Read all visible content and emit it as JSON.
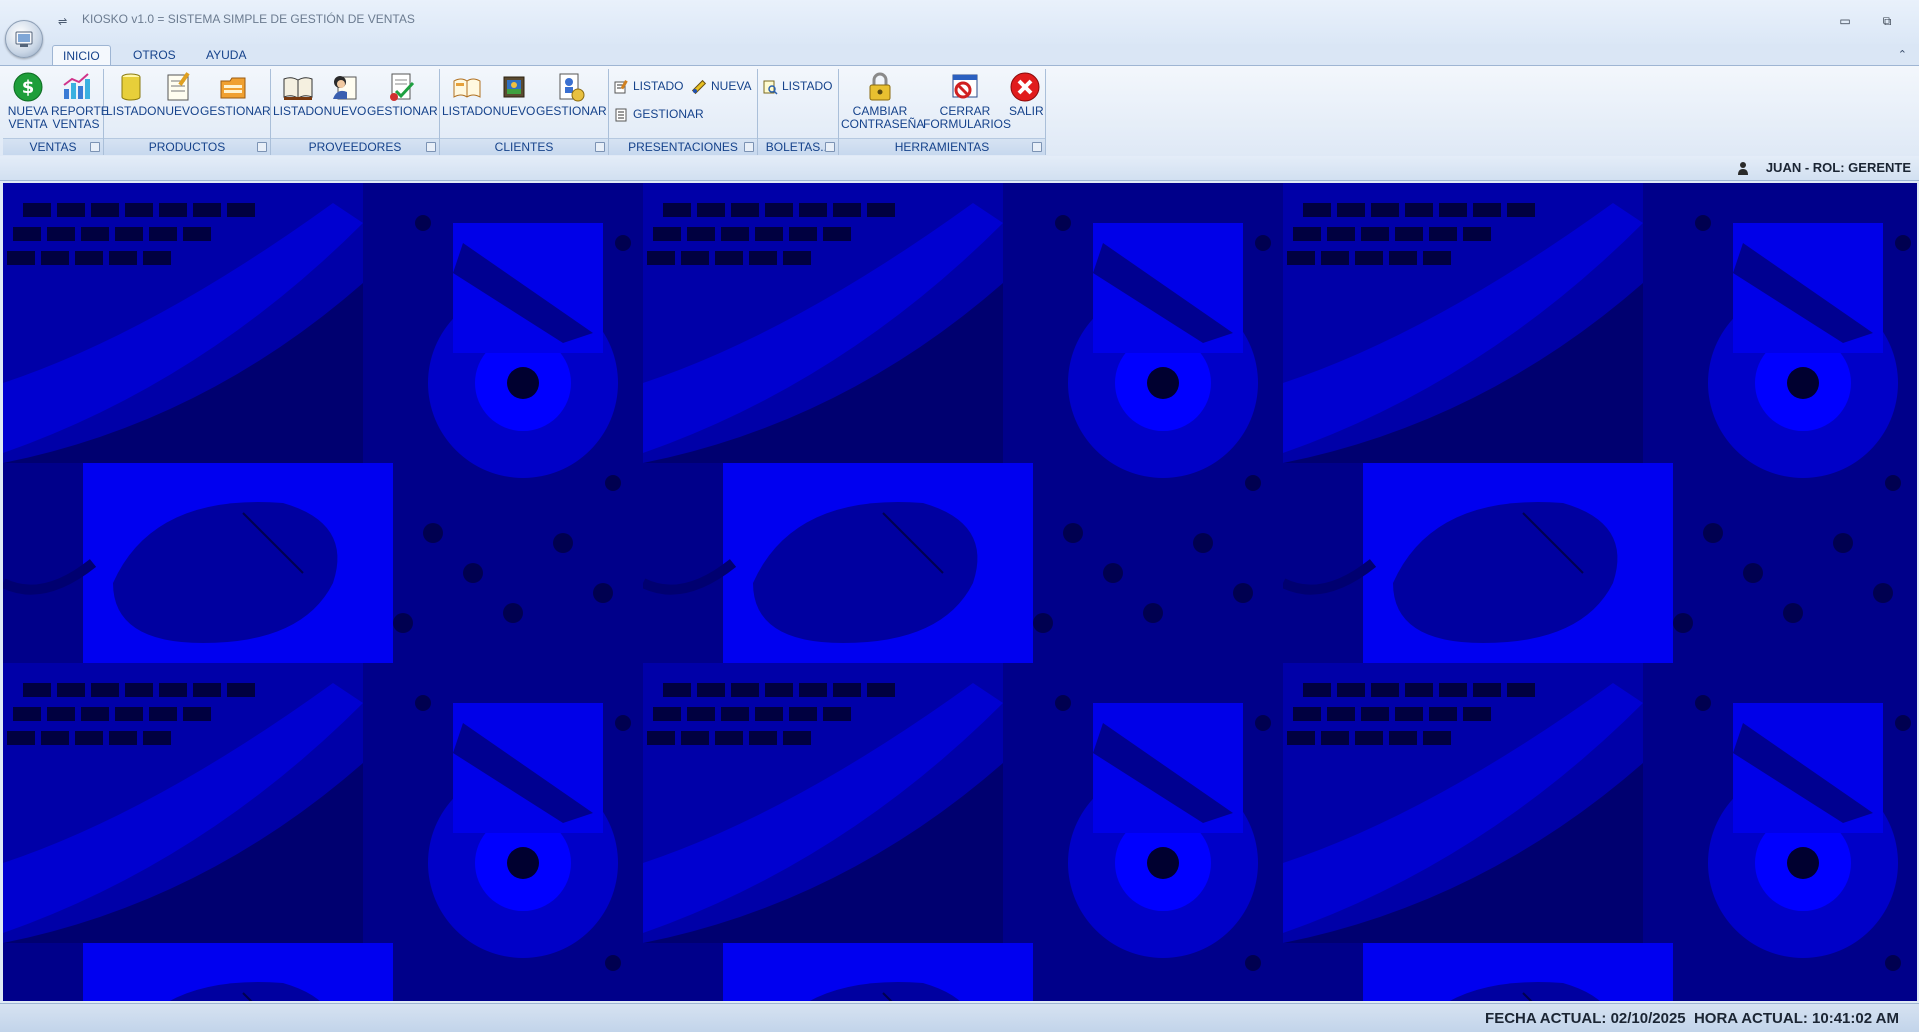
{
  "window": {
    "title": "KIOSKO v1.0 = SISTEMA SIMPLE DE GESTIÓN DE VENTAS",
    "qat_symbol": "⇌",
    "minimize_symbol": "▭",
    "restore_symbol": "⧉"
  },
  "tabs": [
    {
      "label": "INICIO"
    },
    {
      "label": "OTROS"
    },
    {
      "label": "AYUDA"
    }
  ],
  "ribbon_collapse_symbol": "⌃",
  "groups": {
    "ventas": {
      "label": "VENTAS",
      "nueva": "NUEVA\nVENTA",
      "reporte": "REPORTE\nVENTAS"
    },
    "productos": {
      "label": "PRODUCTOS",
      "listado": "LISTADO",
      "nuevo": "NUEVO",
      "gestionar": "GESTIONAR"
    },
    "proveedores": {
      "label": "PROVEEDORES",
      "listado": "LISTADO",
      "nuevo": "NUEVO",
      "gestionar": "GESTIONAR"
    },
    "clientes": {
      "label": "CLIENTES",
      "listado": "LISTADO",
      "nuevo": "NUEVO",
      "gestionar": "GESTIONAR"
    },
    "presentaciones": {
      "label": "PRESENTACIONES",
      "listado": "LISTADO",
      "nueva": "NUEVA",
      "gestionar": "GESTIONAR"
    },
    "boletas": {
      "label": "BOLETAS...",
      "listado": "LISTADO"
    },
    "herramientas": {
      "label": "HERRAMIENTAS",
      "cambiar": "CAMBIAR\nCONTRASEÑA",
      "cerrar": "CERRAR\nFORMULARIOS",
      "salir": "SALIR"
    }
  },
  "user": {
    "label": "JUAN - ROL: GERENTE"
  },
  "status": {
    "text": "FECHA ACTUAL: 02/10/2025  HORA ACTUAL: 10:41:02 AM"
  },
  "colors": {
    "accent": "#15428b",
    "workspace": "#0000c8"
  }
}
